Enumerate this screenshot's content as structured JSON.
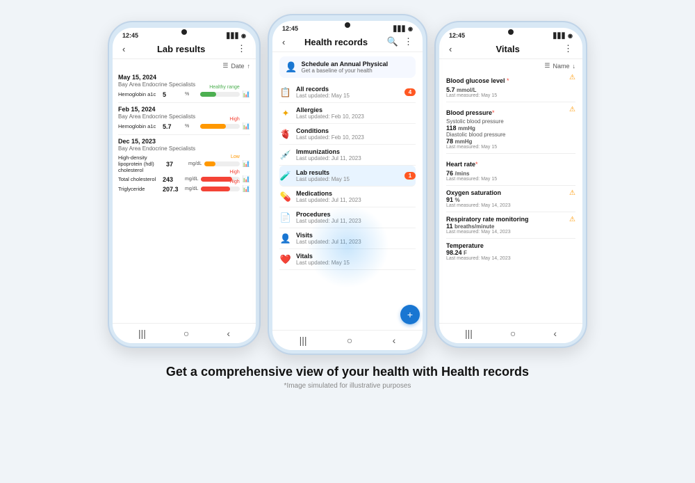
{
  "phones": {
    "phone1": {
      "time": "12:45",
      "title": "Lab results",
      "filter_label": "Date",
      "sections": [
        {
          "date": "May 15, 2024",
          "clinic": "Bay Area Endocrine Specialists",
          "items": [
            {
              "name": "Hemoglobin a1c",
              "value": "5",
              "unit": "%",
              "range": "Healthy range",
              "bar_pct": 40,
              "bar_type": "green"
            }
          ]
        },
        {
          "date": "Feb 15, 2024",
          "clinic": "Bay Area Endocrine Specialists",
          "items": [
            {
              "name": "Hemoglobin a1c",
              "value": "5.7",
              "unit": "%",
              "range": "High",
              "bar_pct": 65,
              "bar_type": "orange"
            }
          ]
        },
        {
          "date": "Dec 15, 2023",
          "clinic": "Bay Area Endocrine Specialists",
          "items": [
            {
              "name": "High-density lipoprotein (hdl) cholesterol",
              "value": "37",
              "unit": "mg/dL",
              "range": "Low",
              "bar_pct": 30,
              "bar_type": "orange"
            },
            {
              "name": "Total cholesterol",
              "value": "243",
              "unit": "mg/dL",
              "range": "High",
              "bar_pct": 80,
              "bar_type": "red"
            },
            {
              "name": "Triglyceride",
              "value": "207.3",
              "unit": "mg/dL",
              "range": "High",
              "bar_pct": 75,
              "bar_type": "red"
            }
          ]
        }
      ]
    },
    "phone2": {
      "time": "12:45",
      "title": "Health records",
      "banner": {
        "title": "Schedule an Annual Physical",
        "subtitle": "Get a baseline of your health"
      },
      "records": [
        {
          "icon": "📋",
          "name": "All records",
          "updated": "Last updated: May 15",
          "badge": "4"
        },
        {
          "icon": "⚡",
          "name": "Allergies",
          "updated": "Last updated: Feb 10, 2023",
          "badge": ""
        },
        {
          "icon": "🫀",
          "name": "Conditions",
          "updated": "Last updated: Feb 10, 2023",
          "badge": ""
        },
        {
          "icon": "💉",
          "name": "Immunizations",
          "updated": "Last updated: Jul 11, 2023",
          "badge": ""
        },
        {
          "icon": "🧪",
          "name": "Lab results",
          "updated": "Last updated: May 15",
          "badge": "1",
          "highlight": true
        },
        {
          "icon": "💊",
          "name": "Medications",
          "updated": "Last updated: Jul 11, 2023",
          "badge": ""
        },
        {
          "icon": "📄",
          "name": "Procedures",
          "updated": "Last updated: Jul 11, 2023",
          "badge": ""
        },
        {
          "icon": "👤",
          "name": "Visits",
          "updated": "Last updated: Jul 11, 2023",
          "badge": ""
        },
        {
          "icon": "❤️",
          "name": "Vitals",
          "updated": "Last updated: May 15",
          "badge": ""
        }
      ]
    },
    "phone3": {
      "time": "12:45",
      "title": "Vitals",
      "filter_label": "Name",
      "vitals": [
        {
          "name": "Blood glucose level",
          "star": true,
          "warn": true,
          "sub_lines": [],
          "value": "5.7",
          "unit": "mmol/L",
          "date": "Last measured: May 15"
        },
        {
          "name": "Blood pressure",
          "star": true,
          "warn": true,
          "sub_lines": [
            "Systolic blood pressure",
            "118 mmHg",
            "Diastolic blood pressure",
            "78 mmHg"
          ],
          "value": "",
          "unit": "",
          "date": "Last measured: May 15"
        },
        {
          "name": "Heart rate",
          "star": true,
          "warn": false,
          "sub_lines": [],
          "value": "76",
          "unit": "/mins",
          "date": "Last measured: May 15"
        },
        {
          "name": "Oxygen saturation",
          "star": false,
          "warn": true,
          "sub_lines": [],
          "value": "91",
          "unit": "%",
          "date": "Last measured: May 14, 2023"
        },
        {
          "name": "Respiratory rate monitoring",
          "star": false,
          "warn": true,
          "sub_lines": [],
          "value": "11",
          "unit": "breaths/minute",
          "date": "Last measured: May 14, 2023"
        },
        {
          "name": "Temperature",
          "star": false,
          "warn": false,
          "sub_lines": [],
          "value": "98.24",
          "unit": "F",
          "date": "Last measured: May 14, 2023"
        }
      ]
    }
  },
  "caption": {
    "title": "Get a comprehensive view of your health with Health records",
    "disclaimer": "*Image simulated for illustrative purposes"
  }
}
